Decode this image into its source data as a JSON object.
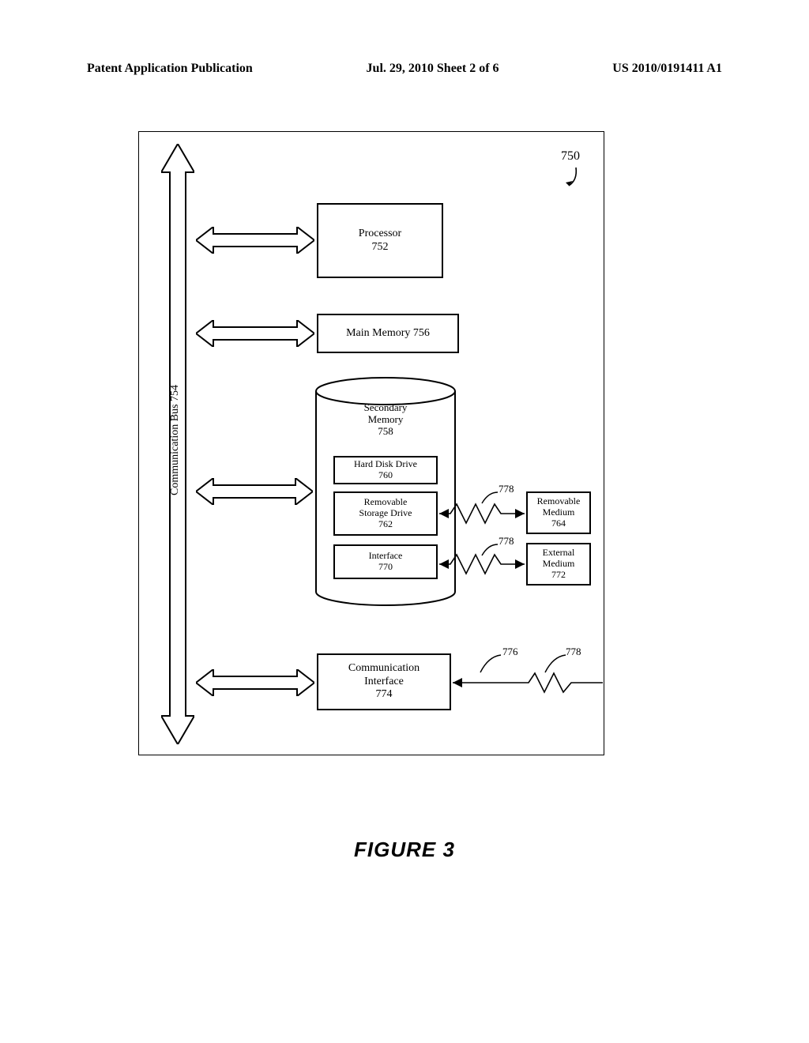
{
  "header": {
    "left": "Patent Application Publication",
    "center": "Jul. 29, 2010  Sheet 2 of 6",
    "right": "US 2010/0191411 A1"
  },
  "figure_caption": "FIGURE 3",
  "callouts": {
    "system_750": "750",
    "c776": "776",
    "c778_a": "778",
    "c778_b": "778",
    "c778_c": "778"
  },
  "bus": {
    "label": "Communication Bus 754"
  },
  "processor": {
    "title": "Processor",
    "ref": "752"
  },
  "main_memory": {
    "label": "Main Memory 756"
  },
  "secondary_memory": {
    "title": "Secondary",
    "title2": "Memory",
    "ref": "758"
  },
  "hdd": {
    "title": "Hard Disk Drive",
    "ref": "760"
  },
  "rsd": {
    "title": "Removable",
    "title2": "Storage Drive",
    "ref": "762"
  },
  "interface": {
    "title": "Interface",
    "ref": "770"
  },
  "removable_medium": {
    "title": "Removable",
    "title2": "Medium",
    "ref": "764"
  },
  "external_medium": {
    "title": "External",
    "title2": "Medium",
    "ref": "772"
  },
  "comm_interface": {
    "title": "Communication",
    "title2": "Interface",
    "ref": "774"
  }
}
